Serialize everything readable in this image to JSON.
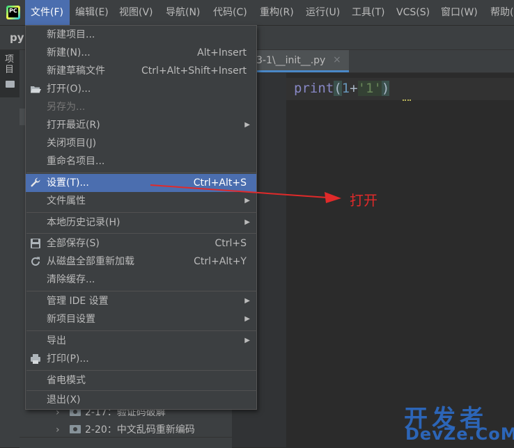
{
  "menubar": {
    "items": [
      "文件(F)",
      "编辑(E)",
      "视图(V)",
      "导航(N)",
      "代码(C)",
      "重构(R)",
      "运行(U)",
      "工具(T)",
      "VCS(S)",
      "窗口(W)",
      "帮助("
    ],
    "active_index": 0
  },
  "logo_text": "PC",
  "project_name": "py",
  "tool_window_label": "项目",
  "editor": {
    "tab_name": "3-1\\__init__.py",
    "tab_close": "×",
    "code": {
      "fn": "print",
      "open": "(",
      "num": "1",
      "op": "+",
      "str": "'1'",
      "close": ")"
    }
  },
  "tree": {
    "rows": [
      {
        "label": "2-17：验证码破解"
      },
      {
        "label": "2-20：中文乱码重新编码"
      }
    ]
  },
  "file_menu": {
    "items": [
      {
        "label": "新建项目...",
        "shortcut": "",
        "submenu": false,
        "icon": "",
        "disabled": false,
        "selected": false
      },
      {
        "label": "新建(N)...",
        "shortcut": "Alt+Insert",
        "submenu": false,
        "icon": "",
        "disabled": false,
        "selected": false
      },
      {
        "label": "新建草稿文件",
        "shortcut": "Ctrl+Alt+Shift+Insert",
        "submenu": false,
        "icon": "",
        "disabled": false,
        "selected": false
      },
      {
        "label": "打开(O)...",
        "shortcut": "",
        "submenu": false,
        "icon": "folder-open-icon",
        "disabled": false,
        "selected": false
      },
      {
        "label": "另存为...",
        "shortcut": "",
        "submenu": false,
        "icon": "",
        "disabled": true,
        "selected": false
      },
      {
        "label": "打开最近(R)",
        "shortcut": "",
        "submenu": true,
        "icon": "",
        "disabled": false,
        "selected": false
      },
      {
        "label": "关闭项目(J)",
        "shortcut": "",
        "submenu": false,
        "icon": "",
        "disabled": false,
        "selected": false
      },
      {
        "label": "重命名项目...",
        "shortcut": "",
        "submenu": false,
        "icon": "",
        "disabled": false,
        "selected": false
      },
      {
        "label": "设置(T)...",
        "shortcut": "Ctrl+Alt+S",
        "submenu": false,
        "icon": "wrench-icon",
        "disabled": false,
        "selected": true
      },
      {
        "label": "文件属性",
        "shortcut": "",
        "submenu": true,
        "icon": "",
        "disabled": false,
        "selected": false
      },
      {
        "label": "本地历史记录(H)",
        "shortcut": "",
        "submenu": true,
        "icon": "",
        "disabled": false,
        "selected": false
      },
      {
        "label": "全部保存(S)",
        "shortcut": "Ctrl+S",
        "submenu": false,
        "icon": "save-icon",
        "disabled": false,
        "selected": false
      },
      {
        "label": "从磁盘全部重新加载",
        "shortcut": "Ctrl+Alt+Y",
        "submenu": false,
        "icon": "reload-icon",
        "disabled": false,
        "selected": false
      },
      {
        "label": "清除缓存...",
        "shortcut": "",
        "submenu": false,
        "icon": "",
        "disabled": false,
        "selected": false
      },
      {
        "label": "管理 IDE 设置",
        "shortcut": "",
        "submenu": true,
        "icon": "",
        "disabled": false,
        "selected": false
      },
      {
        "label": "新项目设置",
        "shortcut": "",
        "submenu": true,
        "icon": "",
        "disabled": false,
        "selected": false
      },
      {
        "label": "导出",
        "shortcut": "",
        "submenu": true,
        "icon": "",
        "disabled": false,
        "selected": false
      },
      {
        "label": "打印(P)...",
        "shortcut": "",
        "submenu": false,
        "icon": "printer-icon",
        "disabled": false,
        "selected": false
      },
      {
        "label": "省电模式",
        "shortcut": "",
        "submenu": false,
        "icon": "",
        "disabled": false,
        "selected": false
      },
      {
        "label": "退出(X)",
        "shortcut": "",
        "submenu": false,
        "icon": "",
        "disabled": false,
        "selected": false
      }
    ],
    "submenu_glyph": "▶"
  },
  "annotation": {
    "text": "打开",
    "color": "#e02a2a"
  },
  "watermark": {
    "line1": "开发者",
    "line2": "DevZe.CoM"
  },
  "colors": {
    "accent": "#4b6eaf",
    "background": "#2b2b2b",
    "panel": "#3c3f41"
  }
}
